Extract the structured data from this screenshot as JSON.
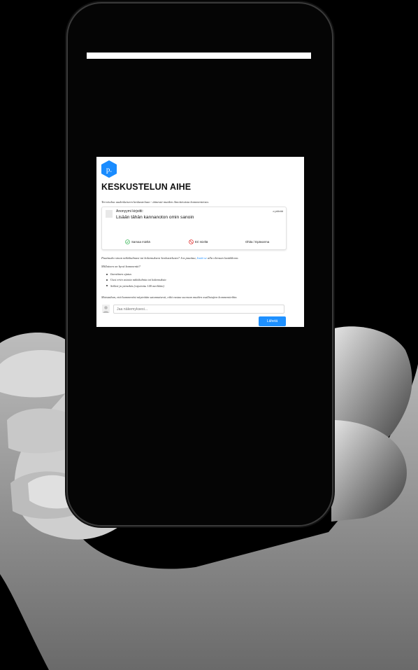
{
  "page": {
    "title": "KESKUSTELUN AIHE",
    "intro": "Tervetuloa uudenlaiseen keskusteluun - äänestä muiden ilmoitetuista kommenteista.",
    "card": {
      "author": "Anonyymi kirjoitti:",
      "time": "a päivää",
      "text": "Lisään tähän kannanoton omin sanoin",
      "votes": [
        {
          "label": "Samaa mieltä",
          "icon": "check-circle-icon",
          "color": "#2bb24c"
        },
        {
          "label": "Eri mieltä",
          "icon": "ban-icon",
          "color": "#e02424"
        },
        {
          "label": "Ohita / Epävarma",
          "icon": "",
          "color": "#222222"
        }
      ]
    },
    "question1_start": "Puuttuuko sinun näkökulmasi tai kokemuksesi keskustelusta? Jos puuttuu,",
    "question1_link": "lisää se",
    "question1_end": "alla olevaan laatikkoon.",
    "question2": "Millainen on hyvä kommentti?",
    "bullets": [
      "Itsenäinen ajatus",
      "Uusi eriin asioita näkökulmia tai kokemuksia",
      "Selkeä ja ytimekäs (rajoitettu 140 merkkiin)"
    ],
    "note": "Muistathan, että kommentisi näytetään satunnaisesti, eikä vastaa suoraan muiden osallistujien kommentteihin.",
    "input_placeholder": "Jaa näkemyksesi...",
    "send_label": "Lähetä",
    "brand_color": "#1a8cff",
    "logo_letter": "p."
  }
}
